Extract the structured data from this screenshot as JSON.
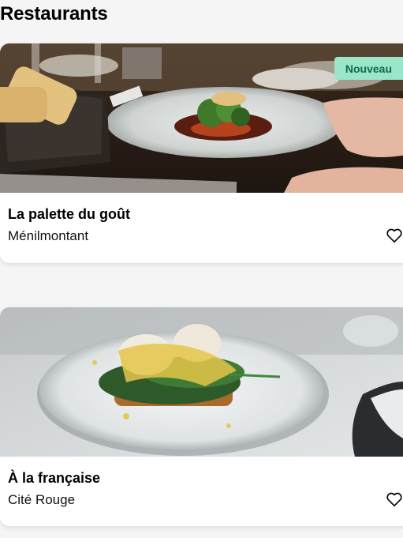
{
  "page": {
    "title": "Restaurants"
  },
  "restaurants": [
    {
      "name": "La palette du goût",
      "area": "Ménilmontant",
      "badge": "Nouveau",
      "favorite": false
    },
    {
      "name": "À la française",
      "area": "Cité Rouge",
      "badge": "",
      "favorite": false
    }
  ],
  "colors": {
    "badge_bg": "#99e6c9",
    "badge_text": "#106b4c",
    "background": "#f5f5f5"
  },
  "icons": {
    "favorite": "heart-outline-icon"
  }
}
